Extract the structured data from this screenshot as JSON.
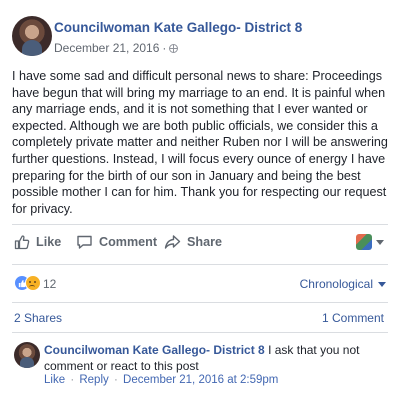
{
  "post": {
    "author": "Councilwoman Kate Gallego- District 8",
    "date": "December 21, 2016",
    "meta_separator": "·",
    "privacy_icon": "globe-icon",
    "text": "I have some sad and difficult personal news to share: Proceedings have begun that will bring my marriage to an end. It is painful when any marriage ends, and it is not something that I ever wanted or expected. Although we are both public officials, we consider this a completely private matter and neither Ruben nor I will be answering further questions. Instead, I will focus every ounce of energy I have preparing for the birth of our son in January and being the best possible mother I can for him. Thank you for respecting our request for privacy."
  },
  "actions": {
    "like_label": "Like",
    "comment_label": "Comment",
    "share_label": "Share",
    "like_icon": "thumbs-up-icon",
    "comment_icon": "speech-bubble-icon",
    "share_icon": "share-arrow-icon"
  },
  "reactions": {
    "count": "12",
    "types": [
      "like",
      "sad"
    ],
    "order_label": "Chronological"
  },
  "stats": {
    "shares": "2 Shares",
    "comments": "1 Comment"
  },
  "comment": {
    "author": "Councilwoman Kate Gallego- District 8",
    "text": "I ask that you not comment or react to this post",
    "like_label": "Like",
    "reply_label": "Reply",
    "separator": "·",
    "timestamp": "December 21, 2016 at 2:59pm"
  },
  "colors": {
    "link_blue": "#365899",
    "secondary_text": "#616770",
    "divider": "#dadde1",
    "like_blue": "#5890ff",
    "sad_yellow": "#f7b125"
  }
}
